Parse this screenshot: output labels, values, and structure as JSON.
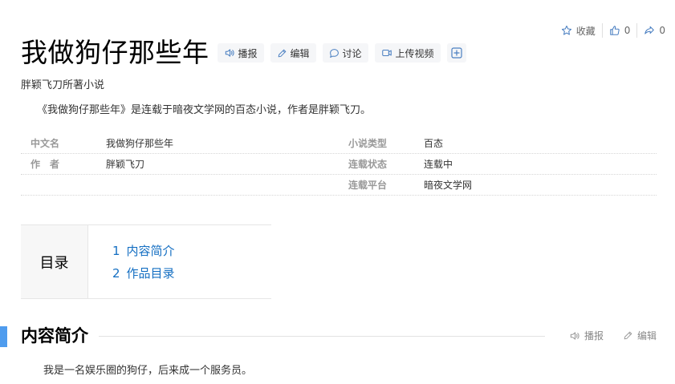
{
  "top_actions": {
    "favorite_label": "收藏",
    "like_count": "0",
    "share_count": "0"
  },
  "header": {
    "title": "我做狗仔那些年",
    "subtitle": "胖颖飞刀所著小说",
    "buttons": {
      "play": "播报",
      "edit": "编辑",
      "discuss": "讨论",
      "upload": "上传视频"
    }
  },
  "summary": "《我做狗仔那些年》是连载于暗夜文学网的百态小说，作者是胖颖飞刀。",
  "info": {
    "rows": [
      {
        "left_label": "中文名",
        "left_value": "我做狗仔那些年",
        "right_label": "小说类型",
        "right_value": "百态"
      },
      {
        "left_label": "作　者",
        "left_value": "胖颖飞刀",
        "right_label": "连载状态",
        "right_value": "连载中"
      },
      {
        "left_label": "",
        "left_value": "",
        "right_label": "连载平台",
        "right_value": "暗夜文学网"
      }
    ]
  },
  "toc": {
    "heading": "目录",
    "items": [
      {
        "num": "1",
        "label": "内容简介"
      },
      {
        "num": "2",
        "label": "作品目录"
      }
    ]
  },
  "section": {
    "title": "内容简介",
    "play": "播报",
    "edit": "编辑",
    "text": "我是一名娱乐圈的狗仔，后来成一个服务员。"
  },
  "colors": {
    "accent": "#4f9cee",
    "link": "#136ec2"
  }
}
